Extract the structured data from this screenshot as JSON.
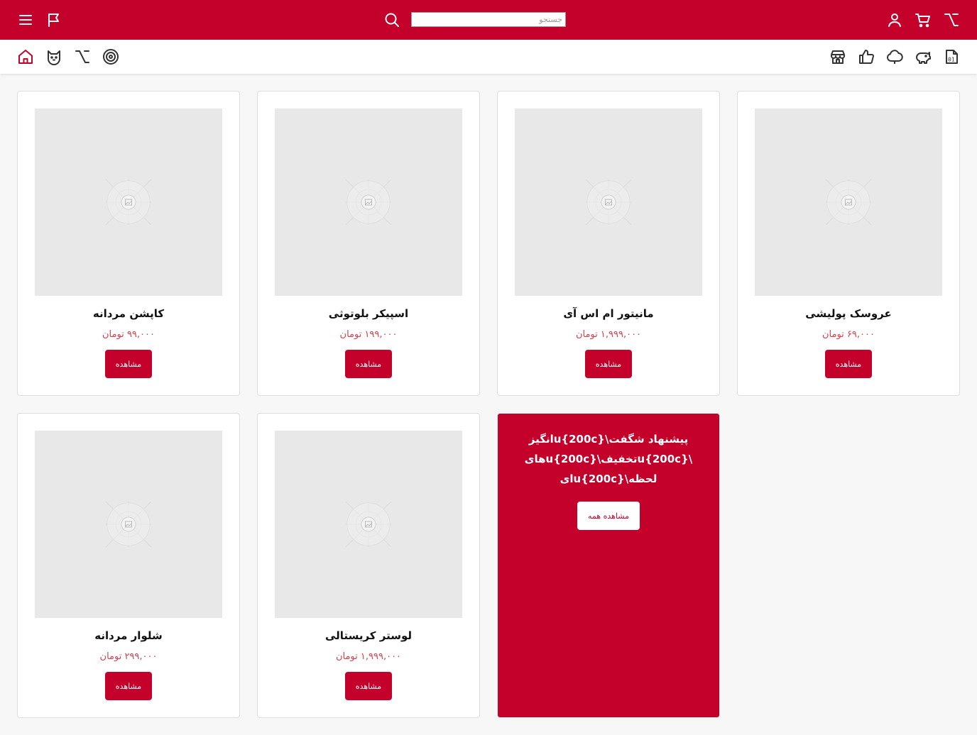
{
  "colors": {
    "brand": "#c4012a",
    "price": "#d1424d",
    "background": "#f7f7f7",
    "placeholder": "#e8e8e8"
  },
  "header": {
    "icons": [
      "menu-icon",
      "flag-icon",
      "search-icon",
      "user-icon",
      "cart-icon",
      "option-icon"
    ],
    "search": {
      "placeholder": "جستجو",
      "value": ""
    }
  },
  "category_bar": {
    "left_icons": [
      "home-icon",
      "cat-icon",
      "option-icon",
      "target-icon"
    ],
    "right_icons": [
      "store-icon",
      "thumbs-up-icon",
      "cloud-icon",
      "piggy-bank-icon",
      "binary-file-icon"
    ]
  },
  "products": [
    {
      "title": "عروسک پولیشی",
      "price": "۶۹,۰۰۰ تومان",
      "button": "مشاهده"
    },
    {
      "title": "مانیتور ام اس آی",
      "price": "۱,۹۹۹,۰۰۰ تومان",
      "button": "مشاهده"
    },
    {
      "title": "اسپیکر بلوتوثی",
      "price": "۱۹۹,۰۰۰ تومان",
      "button": "مشاهده"
    },
    {
      "title": "کاپشن مردانه",
      "price": "۹۹,۰۰۰ تومان",
      "button": "مشاهده"
    },
    {
      "title": "لوستر کریستالی",
      "price": "۱,۹۹۹,۰۰۰ تومان",
      "button": "مشاهده"
    },
    {
      "title": "شلوار مردانه",
      "price": "۲۹۹,۰۰۰ تومان",
      "button": "مشاهده"
    }
  ],
  "promo": {
    "title": "پیشنهاد شگفت\\u{200c}انگیز \\u{200c}تخفیف\\u{200c}های لحظه\\u{200c}ای",
    "button": "مشاهده همه"
  }
}
